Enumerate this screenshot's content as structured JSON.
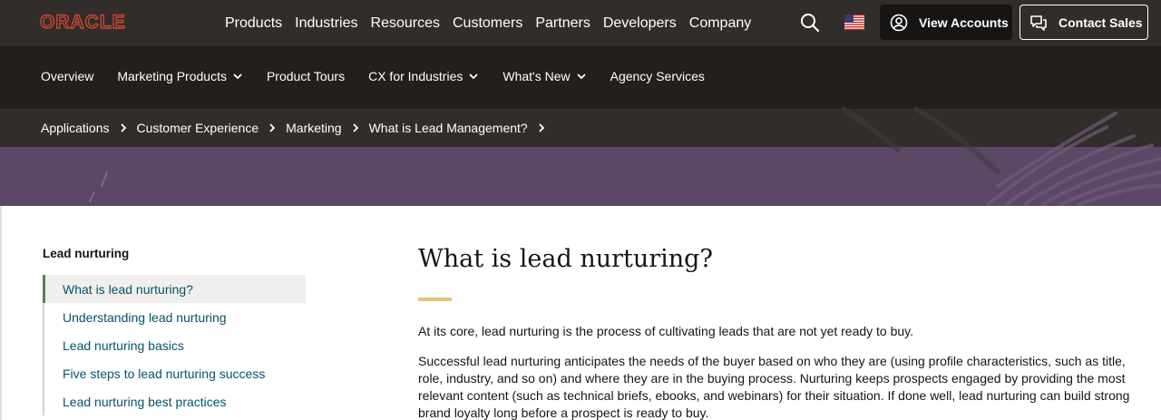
{
  "brand": {
    "logo_text": "ORACLE",
    "accent": "#c74634"
  },
  "header": {
    "nav": [
      "Products",
      "Industries",
      "Resources",
      "Customers",
      "Partners",
      "Developers",
      "Company"
    ],
    "search_icon": "search-icon",
    "flag_icon": "us-flag-icon",
    "view_accounts": "View Accounts",
    "contact_sales": "Contact Sales"
  },
  "subnav": [
    {
      "label": "Overview",
      "dropdown": false
    },
    {
      "label": "Marketing Products",
      "dropdown": true
    },
    {
      "label": "Product Tours",
      "dropdown": false
    },
    {
      "label": "CX for Industries",
      "dropdown": true
    },
    {
      "label": "What's New",
      "dropdown": true
    },
    {
      "label": "Agency Services",
      "dropdown": false
    }
  ],
  "breadcrumb": [
    "Applications",
    "Customer Experience",
    "Marketing",
    "What is Lead Management?"
  ],
  "sidebar": {
    "title": "Lead nurturing",
    "items": [
      {
        "label": "What is lead nurturing?",
        "active": true
      },
      {
        "label": "Understanding lead nurturing",
        "active": false
      },
      {
        "label": "Lead nurturing basics",
        "active": false
      },
      {
        "label": "Five steps to lead nurturing success",
        "active": false
      },
      {
        "label": "Lead nurturing best practices",
        "active": false
      }
    ]
  },
  "main": {
    "title": "What is lead nurturing?",
    "paragraphs": [
      "At its core, lead nurturing is the process of cultivating leads that are not yet ready to buy.",
      "Successful lead nurturing anticipates the needs of the buyer based on who they are (using profile characteristics, such as title, role, industry, and so on) and where they are in the buying process. Nurturing keeps prospects engaged by providing the most relevant content (such as technical briefs, ebooks, and webinars) for their situation. If done well, lead nurturing can build strong brand loyalty long before a prospect is ready to buy."
    ]
  },
  "colors": {
    "topbar": "#312d2a",
    "subbar": "#221f1c",
    "hero": "#5b4864",
    "link": "#04536f",
    "accent_bar": "#e2c379"
  }
}
